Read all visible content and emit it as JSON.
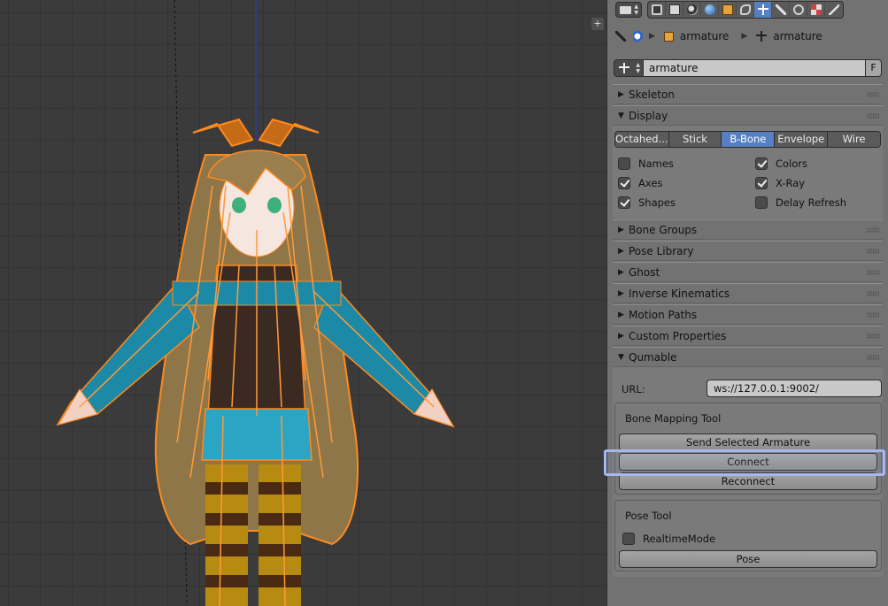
{
  "properties": {
    "header": {
      "editor_icon": "properties-editor-icon",
      "tabs": [
        "render-icon",
        "render-layers-icon",
        "scene-icon",
        "world-icon",
        "object-icon",
        "constraints-icon",
        "data-armature-icon",
        "bone-icon",
        "bone-constraints-icon",
        "material-icon",
        "physics-icon"
      ],
      "active_tab": "data-armature-icon"
    },
    "breadcrumb": {
      "object_name": "armature",
      "data_name": "armature"
    },
    "datablock": {
      "name": "armature",
      "fake_user": "F"
    },
    "panels": {
      "skeleton": "Skeleton",
      "display": "Display",
      "bone_groups": "Bone Groups",
      "pose_library": "Pose Library",
      "ghost": "Ghost",
      "inverse_kinematics": "Inverse Kinematics",
      "motion_paths": "Motion Paths",
      "custom_properties": "Custom Properties",
      "qumable": "Qumable"
    },
    "display": {
      "draw_types": [
        "Octahed...",
        "Stick",
        "B-Bone",
        "Envelope",
        "Wire"
      ],
      "selected_draw_type": "B-Bone",
      "options": {
        "names": {
          "label": "Names",
          "checked": false
        },
        "colors": {
          "label": "Colors",
          "checked": true
        },
        "axes": {
          "label": "Axes",
          "checked": true
        },
        "xray": {
          "label": "X-Ray",
          "checked": true
        },
        "shapes": {
          "label": "Shapes",
          "checked": true
        },
        "delay_refresh": {
          "label": "Delay Refresh",
          "checked": false
        }
      }
    },
    "qumable": {
      "url_label": "URL:",
      "url_value": "ws://127.0.0.1:9002/",
      "bone_mapping": {
        "title": "Bone Mapping Tool",
        "send_button": "Send Selected Armature",
        "connect_button": "Connect",
        "reconnect_button": "Reconnect"
      },
      "pose_tool": {
        "title": "Pose Tool",
        "realtime_label": "RealtimeMode",
        "realtime_checked": false,
        "pose_button": "Pose"
      }
    }
  },
  "colors": {
    "accent": "#5680c2",
    "panel_bg": "#727272",
    "viewport_bg": "#3b3b3b",
    "bone_outline": "#ff8a1e",
    "highlight": "#a7b8f0"
  }
}
